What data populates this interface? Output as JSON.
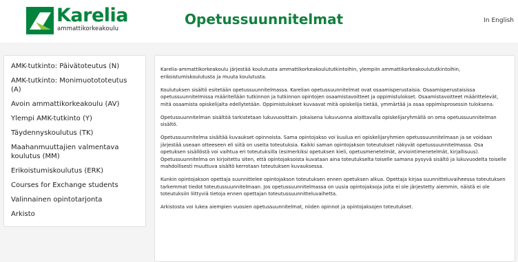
{
  "header": {
    "logo_word": "Karelia",
    "logo_sub": "ammattikorkeakoulu",
    "page_title": "Opetussuunnitelmat",
    "language_link": "In English",
    "brand_color": "#12803f"
  },
  "sidebar": {
    "items": [
      {
        "label": "AMK-tutkinto: Päivätoteutus (N)"
      },
      {
        "label": "AMK-tutkinto: Monimuotototeutus (A)"
      },
      {
        "label": "Avoin ammattikorkeakoulu (AV)"
      },
      {
        "label": "Ylempi AMK-tutkinto (Y)"
      },
      {
        "label": "Täydennyskoulutus (TK)"
      },
      {
        "label": "Maahanmuuttajien valmentava koulutus (MM)"
      },
      {
        "label": "Erikoistumiskoulutus (ERK)"
      },
      {
        "label": "Courses for Exchange students"
      },
      {
        "label": "Valinnainen opintotarjonta"
      },
      {
        "label": "Arkisto"
      }
    ]
  },
  "content": {
    "paragraphs": [
      "Karelia-ammattikorkeakoulu järjestää koulutusta ammattikorkeakoulututkintoihin, ylempiin ammattikorkeakoulututkintoihin, erikoistumiskoulutusta ja muuta koulutusta.",
      "Koulutuksen sisältö esitetään opetussuunnitelmassa. Karelian opetussuunnitelmat ovat osaamisperustaisia. Osaamisperustaisissa opetussuunnitelmissa määritellään tutkinnon ja tutkinnon opintojen osaamistavoitteet ja oppimistulokset. Osaamistavoitteet määrittelevät, mitä osaamista opiskelijalta edellytetään. Oppimistulokset kuvaavat mitä opiskelija tietää, ymmärtää ja osaa oppimisprosessin tuloksena.",
      "Opetussuunnitelman sisältöä tarkistetaan lukuvuosittain. Jokaisena lukuvuonna aloittavalla opiskelijaryhmällä on oma opetussuunnitelman sisältö.",
      "Opetussuunnitelma sisältää kuvaukset opinnoista. Sama opintojakso voi kuulua eri opiskelijaryhmien opetussuunnitelmaan ja se voidaan järjestää useaan otteeseen eli siitä on useita toteutuksia. Kaikki saman opintojakson toteutukset näkyvät opetussuunnitelmassa. Osa opetuksen sisällöstä voi vaihtua eri toteutuksilla (esimerkiksi opetuksen kieli, opetusmenetelmät, arviointimenetelmät, kirjallisuus). Opetussuunnitelma on kirjoitettu siten, että opintojaksoista kuvataan aina toteutukselta toiselle samana pysyvä sisältö ja lukuvuodelta toiselle mahdollisesti muuttuva sisältö kerrotaan toteutuksen kuvauksessa.",
      "Kunkin opintojakson opettaja suunnittelee opintojakson toteutuksen ennen opetuksen alkua. Opettaja kirjaa suunnitteluvaiheessa toteutuksen tarkemmat tiedot toteutussuunnitelmaan. Jos opetussuunnitelmassa on uusia opintojaksoja joita ei ole järjestetty aiemmin, näistä ei ole toteutuksiin liittyviä tietoja ennen opettajan toteutussuunnitteluvaihetta.",
      "Arkistosta voi lukea aiempien vuosien opetussuunnitelmat, niiden opinnot ja opintojaksojen toteutukset."
    ]
  }
}
